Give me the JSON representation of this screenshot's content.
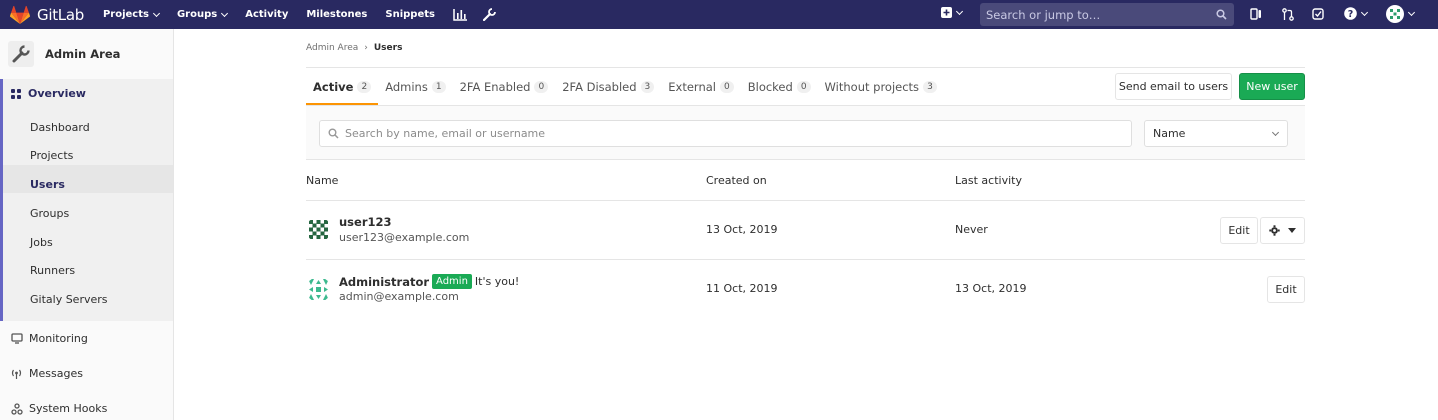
{
  "colors": {
    "navbar": "#292961",
    "accent": "#fc9403",
    "primary_green": "#1aaa55",
    "sidebar_active": "#292961"
  },
  "navbar": {
    "brand": "GitLab",
    "links": [
      "Projects",
      "Groups",
      "Activity",
      "Milestones",
      "Snippets"
    ],
    "search_placeholder": "Search or jump to…",
    "icons": [
      "chart-icon",
      "wrench-icon",
      "plus-icon",
      "todo-icon",
      "merge-request-icon",
      "issues-icon",
      "help-icon",
      "user-avatar-icon"
    ]
  },
  "sidebar": {
    "title": "Admin Area",
    "overview": "Overview",
    "sub_items": [
      "Dashboard",
      "Projects",
      "Users",
      "Groups",
      "Jobs",
      "Runners",
      "Gitaly Servers"
    ],
    "active_sub_item": "Users",
    "items": [
      "Monitoring",
      "Messages",
      "System Hooks"
    ]
  },
  "breadcrumb": {
    "parent": "Admin Area",
    "current": "Users"
  },
  "tabs": [
    {
      "label": "Active",
      "count": "2",
      "active": true
    },
    {
      "label": "Admins",
      "count": "1"
    },
    {
      "label": "2FA Enabled",
      "count": "0"
    },
    {
      "label": "2FA Disabled",
      "count": "3"
    },
    {
      "label": "External",
      "count": "0"
    },
    {
      "label": "Blocked",
      "count": "0"
    },
    {
      "label": "Without projects",
      "count": "3"
    }
  ],
  "buttons": {
    "send_email": "Send email to users",
    "new_user": "New user",
    "edit": "Edit"
  },
  "filter": {
    "placeholder": "Search by name, email or username",
    "sort_value": "Name"
  },
  "table": {
    "headers": {
      "name": "Name",
      "created": "Created on",
      "last_activity": "Last activity"
    },
    "rows": [
      {
        "name": "user123",
        "email": "user123@example.com",
        "created": "13 Oct, 2019",
        "last_activity": "Never"
      },
      {
        "name": "Administrator",
        "badge": "Admin",
        "note": "It's you!",
        "email": "admin@example.com",
        "created": "11 Oct, 2019",
        "last_activity": "13 Oct, 2019"
      }
    ]
  }
}
